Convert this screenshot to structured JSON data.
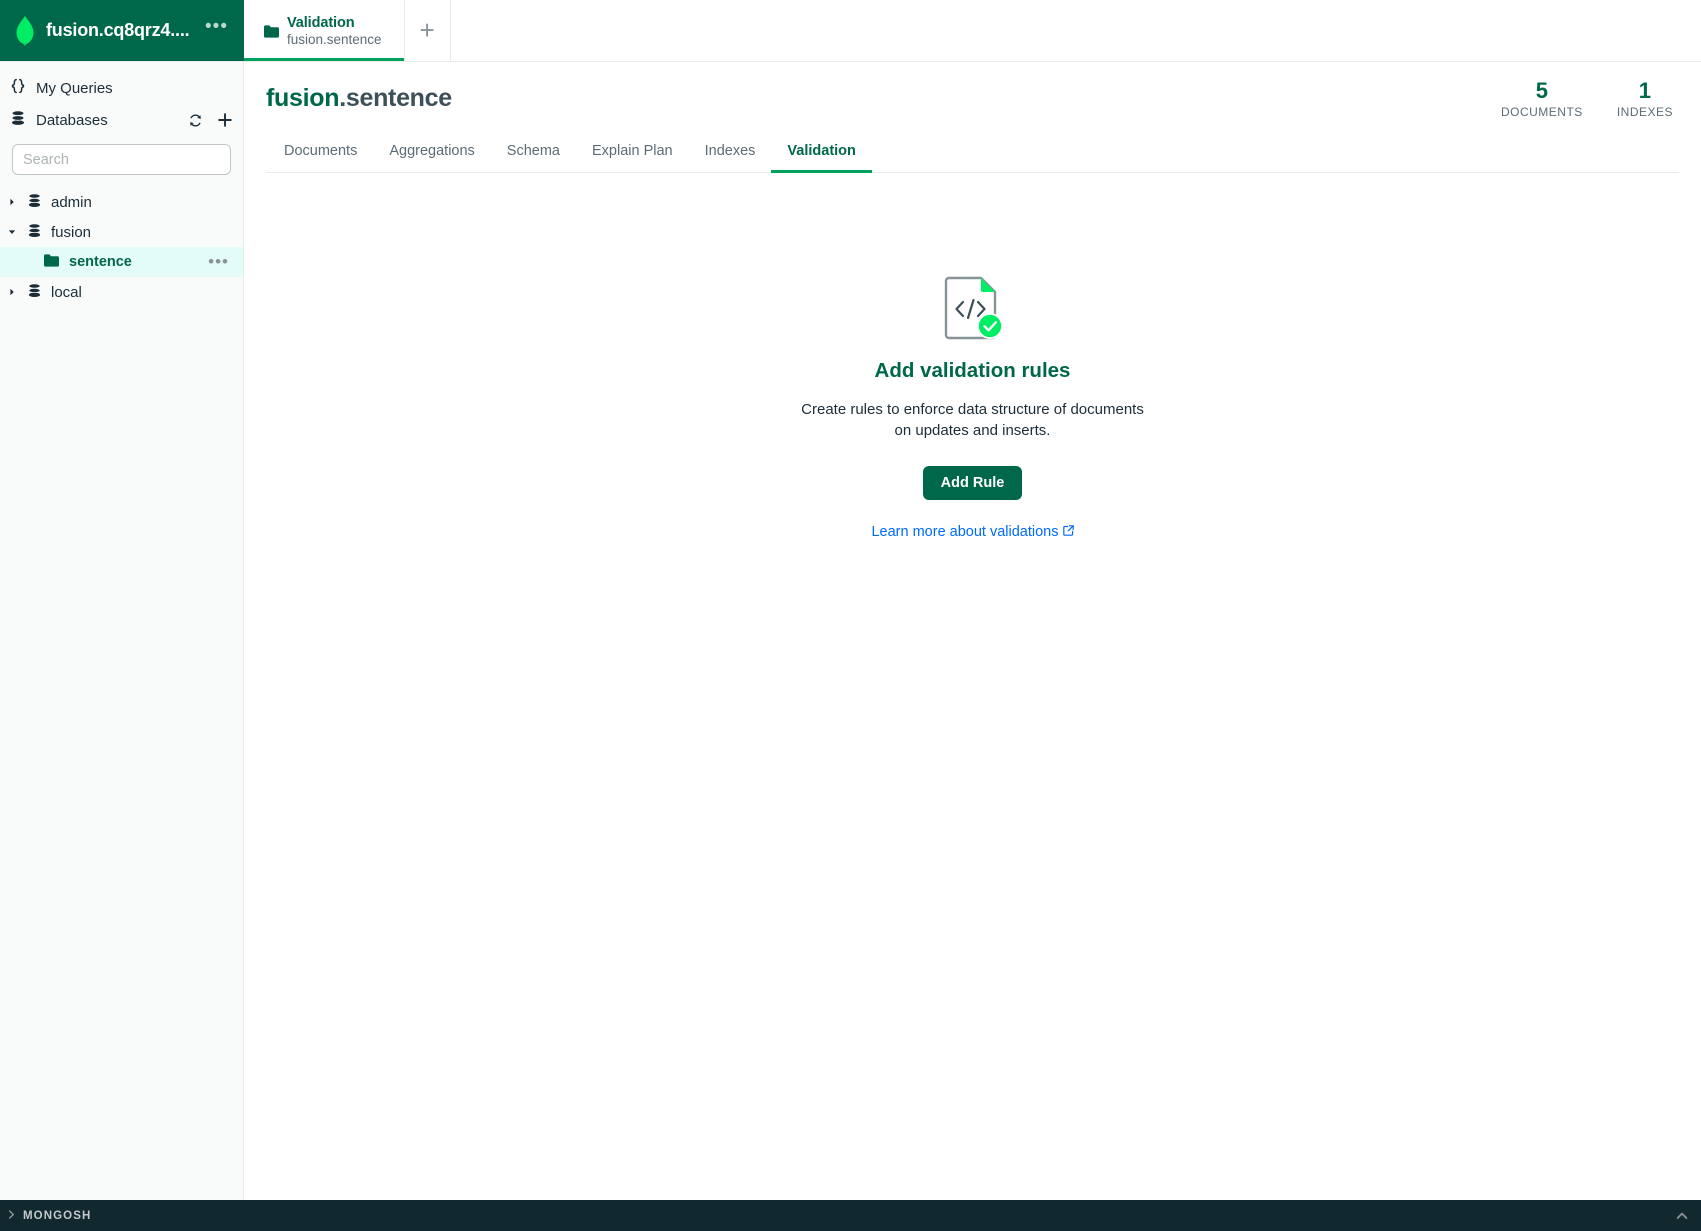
{
  "connection": {
    "name": "fusion.cq8qrz4....",
    "logo_icon": "mongodb-leaf-icon",
    "menu_icon": "connection-overflow-menu-icon"
  },
  "tabs": {
    "open": [
      {
        "icon": "folder-icon",
        "title": "Validation",
        "subtitle": "fusion.sentence",
        "active": true
      }
    ],
    "new_tab_label": "+"
  },
  "sidebar": {
    "my_queries": {
      "label": "My Queries",
      "icon": "curly-braces-icon"
    },
    "databases": {
      "label": "Databases",
      "icon": "database-icon",
      "refresh_icon": "refresh-icon",
      "create_icon": "plus-icon"
    },
    "search": {
      "placeholder": "Search",
      "value": ""
    },
    "tree": [
      {
        "type": "database",
        "label": "admin",
        "expanded": false,
        "icon": "database-icon"
      },
      {
        "type": "database",
        "label": "fusion",
        "expanded": true,
        "icon": "database-icon"
      },
      {
        "type": "collection",
        "label": "sentence",
        "selected": true,
        "icon": "folder-icon",
        "menu_icon": "collection-overflow-menu-icon"
      },
      {
        "type": "database",
        "label": "local",
        "expanded": false,
        "icon": "database-icon"
      }
    ]
  },
  "main": {
    "namespace": {
      "database": "fusion",
      "separator": ".",
      "collection": "sentence"
    },
    "stats": [
      {
        "value": "5",
        "label": "DOCUMENTS"
      },
      {
        "value": "1",
        "label": "INDEXES"
      }
    ],
    "tabs": [
      {
        "label": "Documents",
        "active": false
      },
      {
        "label": "Aggregations",
        "active": false
      },
      {
        "label": "Schema",
        "active": false
      },
      {
        "label": "Explain Plan",
        "active": false
      },
      {
        "label": "Indexes",
        "active": false
      },
      {
        "label": "Validation",
        "active": true
      }
    ],
    "empty_state": {
      "icon": "validation-document-check-icon",
      "title": "Add validation rules",
      "description": "Create rules to enforce data structure of documents on updates and inserts.",
      "primary_button": "Add Rule",
      "link_text": "Learn more about validations",
      "link_icon": "external-link-icon"
    }
  },
  "shell": {
    "label": "MONGOSH",
    "expand_icon": "chevron-right-icon",
    "collapse_icon": "chevron-up-icon"
  },
  "colors": {
    "brand_green_dark": "#00684A",
    "brand_green": "#00A35C",
    "leaf_green": "#00ED64",
    "selected_row_bg": "#E3FCF7",
    "link_blue": "#016BF8",
    "shell_bg": "#12282F",
    "sidebar_bg": "#F9FBFA",
    "text_dark": "#1C2D38",
    "text_muted": "#5C6C75"
  }
}
